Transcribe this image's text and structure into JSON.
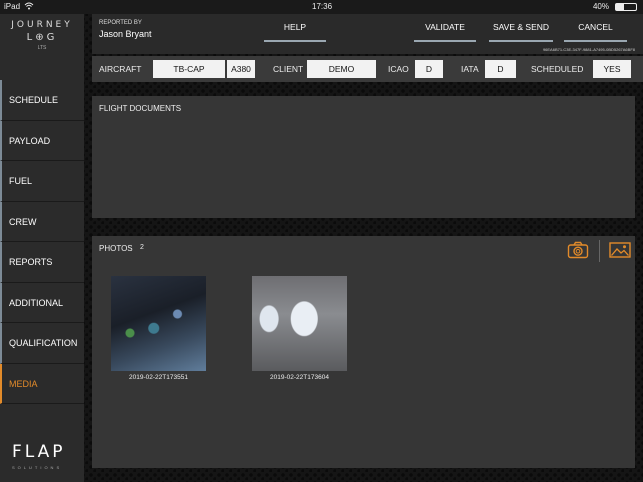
{
  "status_bar": {
    "device": "iPad",
    "wifi_icon": "wifi-icon",
    "time": "17:36",
    "battery_text": "40%",
    "battery_level": 0.4
  },
  "logo": {
    "line1": "JOURNEY",
    "line2": "L⊕G",
    "line3": "LTS"
  },
  "sidebar": {
    "items": [
      {
        "label": "SCHEDULE"
      },
      {
        "label": "PAYLOAD"
      },
      {
        "label": "FUEL"
      },
      {
        "label": "CREW"
      },
      {
        "label": "REPORTS"
      },
      {
        "label": "ADDITIONAL"
      },
      {
        "label": "QUALIFICATION"
      },
      {
        "label": "MEDIA",
        "active": true
      }
    ],
    "brand": "FLAP",
    "brand_sub": "SOLUTIONS"
  },
  "header": {
    "reported_by_label": "REPORTED BY",
    "reporter_name": "Jason Bryant",
    "help_label": "HELP",
    "validate_label": "VALIDATE",
    "save_send_label": "SAVE & SEND",
    "cancel_label": "CANCEL",
    "doc_id": "96EA6B71-C3E-347F-9881-A7495-0BD5267A6BF8"
  },
  "info": {
    "aircraft_label": "AIRCRAFT",
    "aircraft_value": "TB-CAP",
    "aircraft_type": "A380",
    "client_label": "CLIENT",
    "client_value": "DEMO",
    "icao_label": "ICAO",
    "icao_value": "D",
    "iata_label": "IATA",
    "iata_value": "D",
    "scheduled_label": "SCHEDULED",
    "scheduled_value": "YES"
  },
  "documents": {
    "title": "FLIGHT DOCUMENTS"
  },
  "photos": {
    "title": "PHOTOS",
    "count": "2",
    "items": [
      {
        "caption": "2019-02-22T173551"
      },
      {
        "caption": "2019-02-22T173604"
      }
    ]
  },
  "colors": {
    "accent": "#e38b2a",
    "underline": "#9aa7b1"
  }
}
